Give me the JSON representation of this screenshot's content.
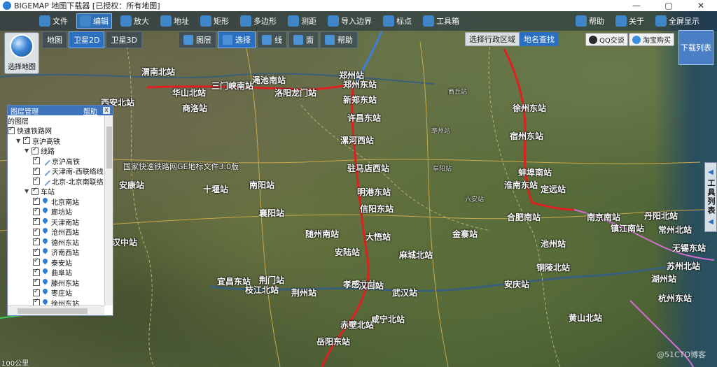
{
  "app": {
    "title": "BIGEMAP 地图下载器 [已授权：所有地图]",
    "window_buttons": [
      "—",
      "▢",
      "✕"
    ]
  },
  "menubar": {
    "items": [
      {
        "label": "文件",
        "icon": "file-icon",
        "active": false
      },
      {
        "label": "编辑",
        "icon": "edit-icon",
        "active": true
      },
      {
        "label": "放大",
        "icon": "zoom-in-icon",
        "active": false
      },
      {
        "label": "地址",
        "icon": "location-icon",
        "active": false
      },
      {
        "label": "矩形",
        "icon": "rectangle-icon",
        "active": false
      },
      {
        "label": "多边形",
        "icon": "polygon-icon",
        "active": false
      },
      {
        "label": "测距",
        "icon": "measure-icon",
        "active": false
      },
      {
        "label": "导入边界",
        "icon": "import-icon",
        "active": false
      },
      {
        "label": "标点",
        "icon": "marker-icon",
        "active": false
      },
      {
        "label": "工具箱",
        "icon": "toolbox-icon",
        "active": false
      },
      {
        "label": "帮助",
        "icon": "help-icon",
        "active": false
      },
      {
        "label": "关于",
        "icon": "about-icon",
        "active": false
      },
      {
        "label": "全屏显示",
        "icon": "fullscreen-icon",
        "active": false
      }
    ]
  },
  "toolbar2": {
    "items": [
      {
        "label": "地图",
        "active": false
      },
      {
        "label": "卫星2D",
        "active": true
      },
      {
        "label": "卫星3D",
        "active": false
      },
      {
        "label": "图层",
        "active": false
      },
      {
        "label": "选择",
        "active": true
      },
      {
        "label": "线",
        "active": false
      },
      {
        "label": "面",
        "active": false
      },
      {
        "label": "帮助",
        "active": false
      }
    ]
  },
  "search": {
    "tab_region": "选择行政区域",
    "tab_place": "地名查找"
  },
  "qq_button": "QQ交谈",
  "taobao_button": "淘宝购买",
  "select_map_button": "选择地图",
  "download_list_button": "下载列表",
  "tool_list_panel": "工具列表",
  "layer_panel": {
    "title": "图层管理",
    "help": "帮助",
    "close": "x",
    "rows": [
      {
        "indent": 0,
        "checkbox": false,
        "expander": "",
        "icon": "",
        "label": "的图层"
      },
      {
        "indent": 0,
        "checkbox": true,
        "expander": "",
        "icon": "",
        "label": "快速铁路网"
      },
      {
        "indent": 1,
        "checkbox": true,
        "expander": "▼",
        "icon": "",
        "label": "京沪高铁"
      },
      {
        "indent": 2,
        "checkbox": true,
        "expander": "▼",
        "icon": "",
        "label": "线路"
      },
      {
        "indent": 3,
        "checkbox": true,
        "expander": "",
        "icon": "line",
        "label": "京沪高铁"
      },
      {
        "indent": 3,
        "checkbox": true,
        "expander": "",
        "icon": "line",
        "label": "天津南-西联络线"
      },
      {
        "indent": 3,
        "checkbox": true,
        "expander": "",
        "icon": "line",
        "label": "北京-北京南联络"
      },
      {
        "indent": 2,
        "checkbox": true,
        "expander": "▼",
        "icon": "",
        "label": "车站"
      },
      {
        "indent": 3,
        "checkbox": true,
        "expander": "",
        "icon": "pin",
        "label": "北京南站"
      },
      {
        "indent": 3,
        "checkbox": true,
        "expander": "",
        "icon": "pin",
        "label": "廊坊站"
      },
      {
        "indent": 3,
        "checkbox": true,
        "expander": "",
        "icon": "pin",
        "label": "天津南站"
      },
      {
        "indent": 3,
        "checkbox": true,
        "expander": "",
        "icon": "pin",
        "label": "沧州西站"
      },
      {
        "indent": 3,
        "checkbox": true,
        "expander": "",
        "icon": "pin",
        "label": "德州东站"
      },
      {
        "indent": 3,
        "checkbox": true,
        "expander": "",
        "icon": "pin",
        "label": "济南西站"
      },
      {
        "indent": 3,
        "checkbox": true,
        "expander": "",
        "icon": "pin",
        "label": "泰安站"
      },
      {
        "indent": 3,
        "checkbox": true,
        "expander": "",
        "icon": "pin",
        "label": "曲阜站"
      },
      {
        "indent": 3,
        "checkbox": true,
        "expander": "",
        "icon": "pin",
        "label": "滕州东站"
      },
      {
        "indent": 3,
        "checkbox": true,
        "expander": "",
        "icon": "pin",
        "label": "枣庄站"
      },
      {
        "indent": 3,
        "checkbox": true,
        "expander": "",
        "icon": "pin",
        "label": "徐州东站"
      }
    ]
  },
  "map": {
    "overlay_text": "国家快速铁路网GE地标文件3.0版",
    "scale": "100公里",
    "watermark": "@51CTO博客",
    "labels": [
      "西安北站",
      "洛阳龙门站",
      "三门峡南站",
      "渑池南站",
      "郑州东站",
      "郑州站",
      "新郑东站",
      "许昌东站",
      "漯河西站",
      "驻马店西站",
      "明港东站",
      "信阳东站",
      "孝感北站",
      "汉口站",
      "武汉站",
      "岳阳东站",
      "赤壁北站",
      "咸宁北站",
      "随州南站",
      "大悟站",
      "安陆站",
      "麻城北站",
      "徐州东站",
      "宿州东站",
      "蚌埠南站",
      "淮南东站",
      "定远站",
      "合肥南站",
      "南京南站",
      "镇江南站",
      "丹阳北站",
      "常州北站",
      "无锡东站",
      "苏州北站",
      "湖州站",
      "杭州东站",
      "安庆站",
      "池州站",
      "铜陵北站",
      "黄山北站",
      "商丘站",
      "亳州站",
      "阜阳站",
      "六安站",
      "金寨站",
      "南阳站",
      "襄阳站",
      "荆门站",
      "荆州站",
      "宜昌东站",
      "枝江北站",
      "十堰站",
      "安康站",
      "汉中站",
      "商洛站",
      "华山北站",
      "渭南北站"
    ]
  },
  "colors": {
    "railway_red": "#e02020",
    "railway_blue": "#3d7fd8",
    "toolbar_active": "#2c6fbf",
    "panel_header": "#3d73bb"
  }
}
